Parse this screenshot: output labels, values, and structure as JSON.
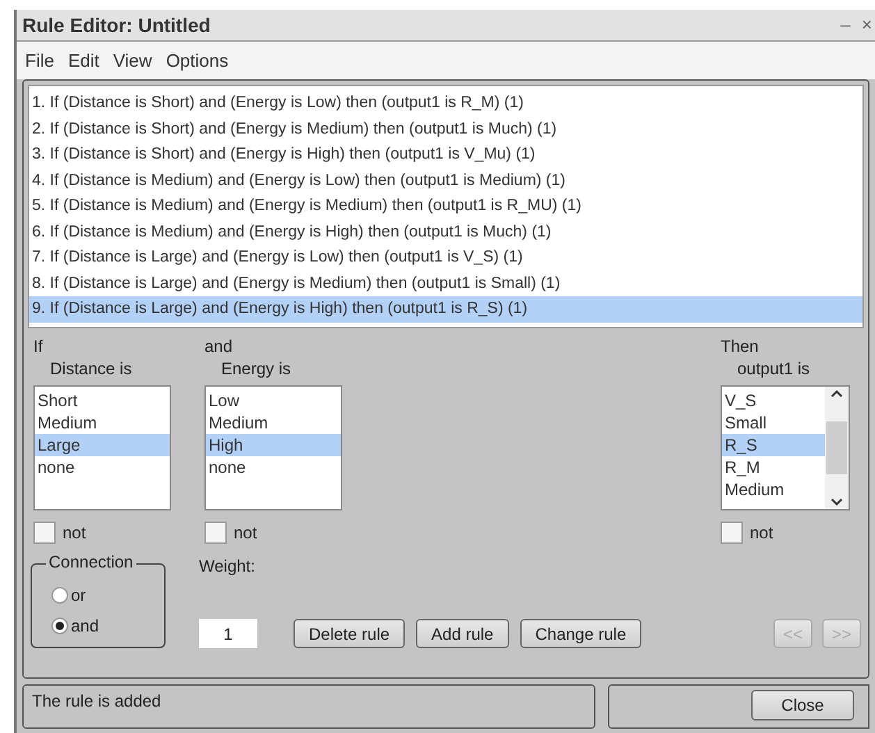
{
  "window": {
    "title": "Rule Editor: Untitled",
    "controls": [
      "–",
      "×"
    ]
  },
  "menu": [
    "File",
    "Edit",
    "View",
    "Options"
  ],
  "rules": [
    {
      "text": "1. If (Distance is Short) and (Energy is Low) then (output1 is R_M) (1)",
      "selected": false
    },
    {
      "text": "2. If (Distance is Short) and (Energy is Medium) then (output1 is Much) (1)",
      "selected": false
    },
    {
      "text": "3. If (Distance is Short) and (Energy is High) then (output1 is V_Mu) (1)",
      "selected": false
    },
    {
      "text": "4. If (Distance is Medium) and (Energy is Low) then (output1 is Medium) (1)",
      "selected": false
    },
    {
      "text": "5. If (Distance is Medium) and (Energy is Medium) then (output1 is R_MU) (1)",
      "selected": false
    },
    {
      "text": "6. If (Distance is Medium) and (Energy is High) then (output1 is Much) (1)",
      "selected": false
    },
    {
      "text": "7. If (Distance is Large) and (Energy is Low) then (output1 is V_S) (1)",
      "selected": false
    },
    {
      "text": "8. If (Distance is Large) and (Energy is Medium) then (output1 is Small) (1)",
      "selected": false
    },
    {
      "text": "9. If (Distance is Large) and (Energy is High) then (output1 is R_S) (1)",
      "selected": true
    }
  ],
  "variables": [
    {
      "connector": "If",
      "label": "Distance is",
      "scrollable": false,
      "not_checked": false,
      "not_label": "not",
      "items": [
        {
          "text": "Short",
          "selected": false
        },
        {
          "text": "Medium",
          "selected": false
        },
        {
          "text": "Large",
          "selected": true
        },
        {
          "text": "none",
          "selected": false
        }
      ]
    },
    {
      "connector": "and",
      "label": "Energy is",
      "scrollable": false,
      "not_checked": false,
      "not_label": "not",
      "items": [
        {
          "text": "Low",
          "selected": false
        },
        {
          "text": "Medium",
          "selected": false
        },
        {
          "text": "High",
          "selected": true
        },
        {
          "text": "none",
          "selected": false
        }
      ]
    },
    {
      "connector": "Then",
      "label": "output1 is",
      "scrollable": true,
      "not_checked": false,
      "not_label": "not",
      "items": [
        {
          "text": "V_S",
          "selected": false
        },
        {
          "text": "Small",
          "selected": false
        },
        {
          "text": "R_S",
          "selected": true
        },
        {
          "text": "R_M",
          "selected": false
        },
        {
          "text": "Medium",
          "selected": false
        }
      ]
    }
  ],
  "connection": {
    "title": "Connection",
    "options": [
      {
        "label": "or",
        "selected": false
      },
      {
        "label": "and",
        "selected": true
      }
    ]
  },
  "weight": {
    "label": "Weight:",
    "value": "1"
  },
  "buttons": [
    {
      "label": "Delete rule",
      "disabled": false
    },
    {
      "label": "Add rule",
      "disabled": false
    },
    {
      "label": "Change rule",
      "disabled": false
    }
  ],
  "nav_buttons": [
    {
      "label": "<<",
      "disabled": true
    },
    {
      "label": ">>",
      "disabled": true
    }
  ],
  "status": {
    "message": "The rule is added",
    "close": "Close"
  }
}
